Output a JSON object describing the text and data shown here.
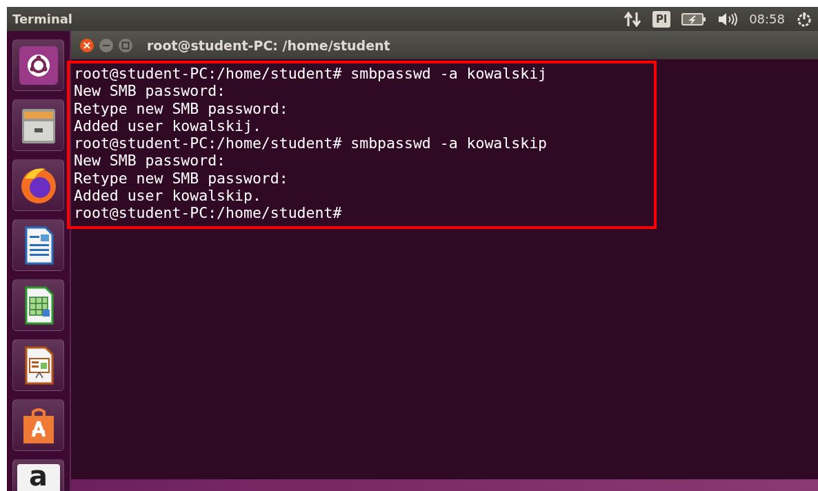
{
  "top_panel": {
    "app_title": "Terminal",
    "keyboard_layout": "Pl",
    "clock": "08:58"
  },
  "launcher": {
    "items": [
      {
        "kind": "dash"
      },
      {
        "kind": "files"
      },
      {
        "kind": "browser"
      },
      {
        "kind": "writer"
      },
      {
        "kind": "calc"
      },
      {
        "kind": "impress"
      },
      {
        "kind": "store"
      },
      {
        "kind": "letter",
        "letter": "a"
      }
    ]
  },
  "terminal": {
    "title": "root@student-PC: /home/student",
    "highlight_frame": true,
    "lines": [
      {
        "text": "root@student-PC:/home/student# smbpasswd -a kowalskij"
      },
      {
        "text": "New SMB password:"
      },
      {
        "text": "Retype new SMB password:"
      },
      {
        "text": "Added user kowalskij."
      },
      {
        "text": "root@student-PC:/home/student# smbpasswd -a kowalskip"
      },
      {
        "text": "New SMB password:"
      },
      {
        "text": "Retype new SMB password:"
      },
      {
        "text": "Added user kowalskip."
      },
      {
        "text": "root@student-PC:/home/student#"
      }
    ]
  }
}
